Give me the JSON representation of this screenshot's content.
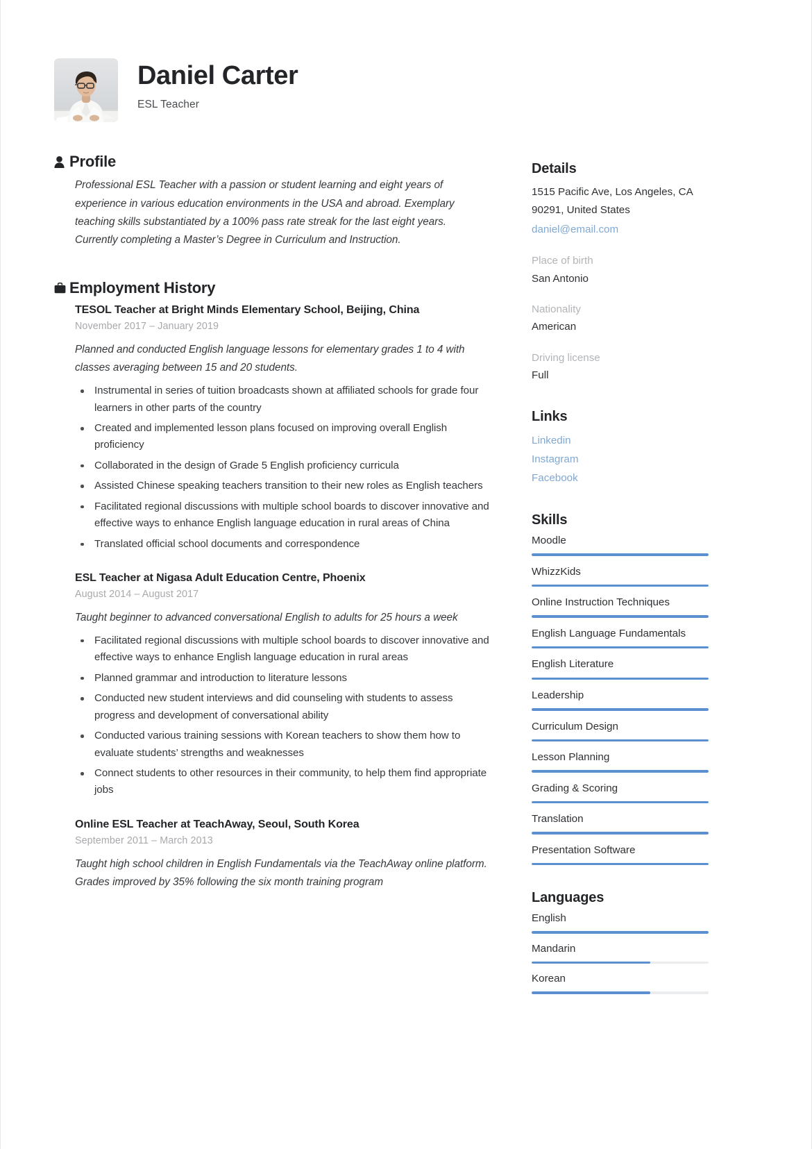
{
  "colors": {
    "accent": "#5b8fd0",
    "link": "#7fa8d4",
    "heading": "#232528",
    "muted": "#b2b4b7",
    "body": "#35383b",
    "track": "#ebecee"
  },
  "header": {
    "name": "Daniel Carter",
    "job_title": "ESL Teacher",
    "avatar_alt": "portrait-photo"
  },
  "profile": {
    "heading": "Profile",
    "icon": "person-icon",
    "summary": "Professional ESL Teacher with a passion or student learning and eight years of experience in various education environments in the USA and abroad. Exemplary teaching skills substantiated by a 100% pass rate streak for the last eight years. Currently completing a Master’s Degree in Curriculum and Instruction."
  },
  "employment": {
    "heading": "Employment History",
    "icon": "briefcase-icon",
    "jobs": [
      {
        "title": "TESOL Teacher at Bright Minds Elementary School, Beijing, China",
        "dates": "November 2017  –  January 2019",
        "description": "Planned and conducted English language lessons for elementary grades 1 to 4 with classes averaging between 15 and 20 students.",
        "bullets": [
          "Instrumental in series of tuition broadcasts shown at affiliated schools for grade four learners in other parts of the country",
          "Created and implemented lesson plans focused on improving overall English proficiency",
          "Collaborated in the design of Grade 5 English proficiency curricula",
          "Assisted Chinese speaking teachers transition to their new roles as English teachers",
          "Facilitated regional discussions with multiple school boards to discover innovative and effective ways to enhance English language education in rural areas of China",
          "Translated official school documents and correspondence"
        ]
      },
      {
        "title": "ESL Teacher at Nigasa Adult Education Centre, Phoenix",
        "dates": "August 2014  –  August 2017",
        "description": "Taught beginner to advanced conversational English to adults for 25 hours a week",
        "bullets": [
          "Facilitated regional discussions with multiple school boards to discover innovative and effective ways to enhance English language education in rural areas",
          "Planned grammar and introduction to literature lessons",
          "Conducted new student interviews and did counseling with students to assess progress and development of conversational ability",
          "Conducted various training sessions with Korean teachers to show them how to evaluate students’ strengths and weaknesses",
          "Connect students to other resources in their community, to help them find appropriate jobs"
        ]
      },
      {
        "title": "Online ESL Teacher at TeachAway, Seoul, South Korea",
        "dates": "September 2011  –  March 2013",
        "description": "Taught high school children in English Fundamentals via the TeachAway online platform. Grades improved by 35% following the six month training program",
        "bullets": []
      }
    ]
  },
  "details": {
    "heading": "Details",
    "address_line1": "1515 Pacific Ave, Los Angeles, CA",
    "address_line2": "90291, United States",
    "email": "daniel@email.com",
    "fields": [
      {
        "label": "Place of birth",
        "value": "San Antonio"
      },
      {
        "label": "Nationality",
        "value": "American"
      },
      {
        "label": "Driving license",
        "value": "Full"
      }
    ]
  },
  "links": {
    "heading": "Links",
    "items": [
      "Linkedin",
      "Instagram",
      "Facebook"
    ]
  },
  "skills": {
    "heading": "Skills",
    "items": [
      {
        "name": "Moodle",
        "level": 100
      },
      {
        "name": "WhizzKids",
        "level": 100
      },
      {
        "name": "Online Instruction Techniques",
        "level": 100
      },
      {
        "name": "English Language Fundamentals",
        "level": 100
      },
      {
        "name": "English Literature",
        "level": 100
      },
      {
        "name": "Leadership",
        "level": 100
      },
      {
        "name": "Curriculum Design",
        "level": 100
      },
      {
        "name": "Lesson Planning",
        "level": 100
      },
      {
        "name": "Grading & Scoring",
        "level": 100
      },
      {
        "name": "Translation",
        "level": 100
      },
      {
        "name": "Presentation Software",
        "level": 100
      }
    ]
  },
  "languages": {
    "heading": "Languages",
    "items": [
      {
        "name": "English",
        "level": 100
      },
      {
        "name": "Mandarin",
        "level": 67
      },
      {
        "name": "Korean",
        "level": 67
      }
    ]
  }
}
